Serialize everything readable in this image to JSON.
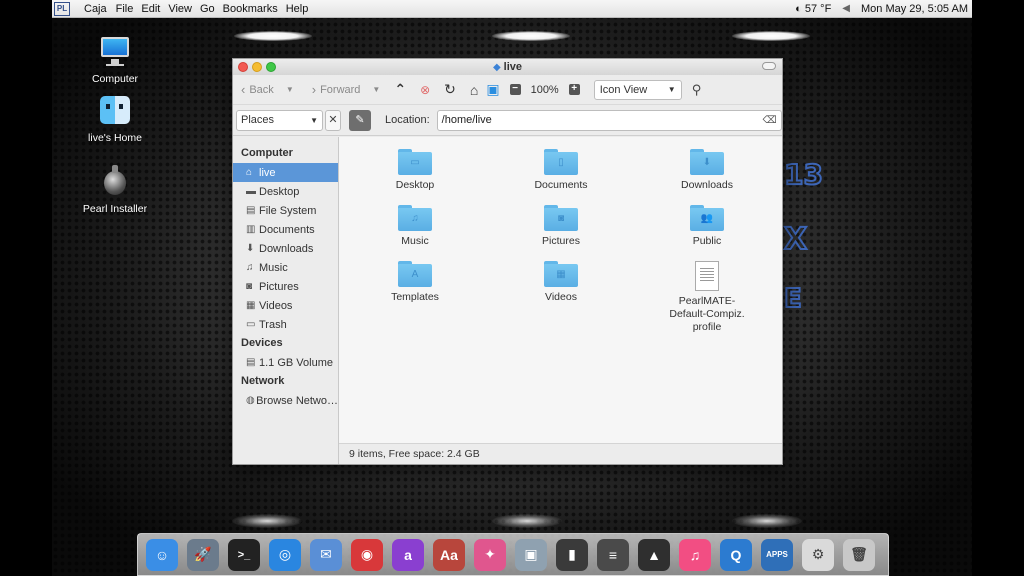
{
  "menubar": {
    "logo": "PL",
    "app": "Caja",
    "items": [
      "File",
      "Edit",
      "View",
      "Go",
      "Bookmarks",
      "Help"
    ],
    "weather": "57 °F",
    "datetime": "Mon May 29, 5:05 AM"
  },
  "desktop": {
    "icons": [
      {
        "label": "Computer",
        "icon": "computer-icon"
      },
      {
        "label": "live's Home",
        "icon": "finder-home-icon"
      },
      {
        "label": "Pearl Installer",
        "icon": "installer-icon"
      }
    ]
  },
  "window": {
    "title": "live",
    "toolbar": {
      "back": "Back",
      "forward": "Forward",
      "zoom": "100%",
      "view": "Icon View"
    },
    "places_label": "Places",
    "location_label": "Location:",
    "location_value": "/home/live",
    "sidebar": {
      "computer_header": "Computer",
      "computer_items": [
        {
          "label": "live",
          "icon": "home-icon",
          "glyph": "⌂"
        },
        {
          "label": "Desktop",
          "icon": "desktop-icon",
          "glyph": "▬"
        },
        {
          "label": "File System",
          "icon": "drive-icon",
          "glyph": "▤"
        },
        {
          "label": "Documents",
          "icon": "documents-icon",
          "glyph": "▥"
        },
        {
          "label": "Downloads",
          "icon": "downloads-icon",
          "glyph": "⬇"
        },
        {
          "label": "Music",
          "icon": "music-icon",
          "glyph": "♫"
        },
        {
          "label": "Pictures",
          "icon": "pictures-icon",
          "glyph": "◙"
        },
        {
          "label": "Videos",
          "icon": "videos-icon",
          "glyph": "▦"
        },
        {
          "label": "Trash",
          "icon": "trash-icon",
          "glyph": "▭"
        }
      ],
      "devices_header": "Devices",
      "devices_items": [
        {
          "label": "1.1 GB Volume",
          "icon": "volume-icon",
          "glyph": "▤"
        }
      ],
      "network_header": "Network",
      "network_items": [
        {
          "label": "Browse Netwo…",
          "icon": "network-icon",
          "glyph": "◍"
        }
      ]
    },
    "files": [
      {
        "name": "Desktop",
        "type": "folder",
        "emblem": "▭"
      },
      {
        "name": "Documents",
        "type": "folder",
        "emblem": "▯"
      },
      {
        "name": "Downloads",
        "type": "folder",
        "emblem": "⬇"
      },
      {
        "name": "Music",
        "type": "folder",
        "emblem": "♫"
      },
      {
        "name": "Pictures",
        "type": "folder",
        "emblem": "◙"
      },
      {
        "name": "Public",
        "type": "folder",
        "emblem": "👥"
      },
      {
        "name": "Templates",
        "type": "folder",
        "emblem": "A"
      },
      {
        "name": "Videos",
        "type": "folder",
        "emblem": "▦"
      },
      {
        "name": "PearlMATE-\nDefault-Compiz.\nprofile",
        "type": "file",
        "emblem": ""
      }
    ],
    "status": "9 items, Free space: 2.4 GB"
  },
  "dock": {
    "apps": [
      {
        "name": "finder",
        "color": "#3a8ee6"
      },
      {
        "name": "launchpad",
        "color": "#6b7b8c"
      },
      {
        "name": "terminal",
        "color": "#222222"
      },
      {
        "name": "safari",
        "color": "#2a86e0"
      },
      {
        "name": "mail",
        "color": "#5a8fd6"
      },
      {
        "name": "screen-recorder",
        "color": "#d8383a"
      },
      {
        "name": "app-a",
        "color": "#8a3fd0"
      },
      {
        "name": "dictionary",
        "color": "#b8463c"
      },
      {
        "name": "browser",
        "color": "#e0568e"
      },
      {
        "name": "preview",
        "color": "#8fa1b0"
      },
      {
        "name": "video-editor",
        "color": "#3a3a3a"
      },
      {
        "name": "mixer",
        "color": "#4a4a4a"
      },
      {
        "name": "inkscape",
        "color": "#2f2f2f"
      },
      {
        "name": "itunes",
        "color": "#f24e83"
      },
      {
        "name": "quicktime",
        "color": "#2c7bd0"
      },
      {
        "name": "apps",
        "color": "#2f6fb8"
      },
      {
        "name": "settings",
        "color": "#dadada"
      },
      {
        "name": "trash",
        "color": "#c8c8c8"
      }
    ],
    "apps_label": "APPS"
  }
}
